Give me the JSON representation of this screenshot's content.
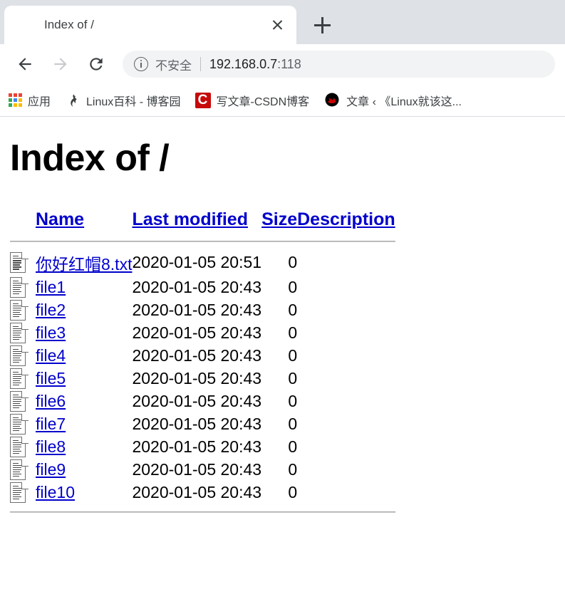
{
  "browser": {
    "tab": {
      "title": "Index of /",
      "favicon": "globe-icon",
      "close_label": "Close tab"
    },
    "new_tab_label": "New tab",
    "nav": {
      "back": "Back",
      "forward": "Forward",
      "reload": "Reload"
    },
    "omnibox": {
      "security_icon": "info-circle-icon",
      "security_text": "不安全",
      "url_host": "192.168.0.7",
      "url_port": ":118",
      "full_url": "192.168.0.7:118"
    },
    "bookmarks": [
      {
        "label": "应用",
        "icon": "apps-grid-icon"
      },
      {
        "label": "Linux百科 - 博客园",
        "icon": "cnblogs-icon"
      },
      {
        "label": "写文章-CSDN博客",
        "icon": "csdn-icon"
      },
      {
        "label": "文章 ‹ 《Linux就该这...",
        "icon": "redhat-icon"
      }
    ]
  },
  "page": {
    "heading": "Index of /",
    "columns": {
      "name": "Name",
      "last_modified": "Last modified",
      "size": "Size",
      "description": "Description"
    },
    "files": [
      {
        "icon": "text-file-icon",
        "name": "你好红帽8.txt",
        "last_modified": "2020-01-05 20:51",
        "size": "0",
        "description": ""
      },
      {
        "icon": "text-file-icon",
        "name": "file1",
        "last_modified": "2020-01-05 20:43",
        "size": "0",
        "description": ""
      },
      {
        "icon": "text-file-icon",
        "name": "file2",
        "last_modified": "2020-01-05 20:43",
        "size": "0",
        "description": ""
      },
      {
        "icon": "text-file-icon",
        "name": "file3",
        "last_modified": "2020-01-05 20:43",
        "size": "0",
        "description": ""
      },
      {
        "icon": "text-file-icon",
        "name": "file4",
        "last_modified": "2020-01-05 20:43",
        "size": "0",
        "description": ""
      },
      {
        "icon": "text-file-icon",
        "name": "file5",
        "last_modified": "2020-01-05 20:43",
        "size": "0",
        "description": ""
      },
      {
        "icon": "text-file-icon",
        "name": "file6",
        "last_modified": "2020-01-05 20:43",
        "size": "0",
        "description": ""
      },
      {
        "icon": "text-file-icon",
        "name": "file7",
        "last_modified": "2020-01-05 20:43",
        "size": "0",
        "description": ""
      },
      {
        "icon": "text-file-icon",
        "name": "file8",
        "last_modified": "2020-01-05 20:43",
        "size": "0",
        "description": ""
      },
      {
        "icon": "text-file-icon",
        "name": "file9",
        "last_modified": "2020-01-05 20:43",
        "size": "0",
        "description": ""
      },
      {
        "icon": "text-file-icon",
        "name": "file10",
        "last_modified": "2020-01-05 20:43",
        "size": "0",
        "description": ""
      }
    ]
  },
  "colors": {
    "link": "#0000cc",
    "tabstrip_bg": "#dee1e6",
    "omnibox_bg": "#f1f3f4",
    "text_dark": "#202124",
    "text_gray": "#5f6368",
    "csdn_red": "#c60a0a",
    "redhat_red": "#cc0000"
  }
}
